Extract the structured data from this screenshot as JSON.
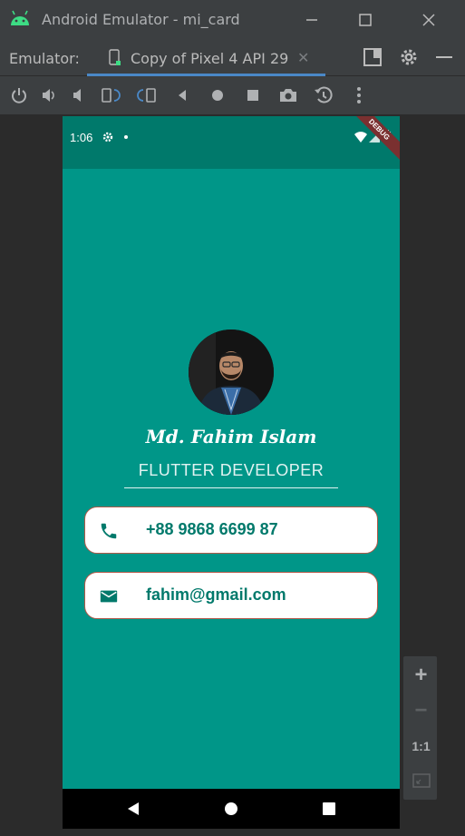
{
  "window": {
    "title": "Android Emulator - mi_card"
  },
  "tabbar": {
    "label": "Emulator:",
    "tab_title": "Copy of Pixel 4 API 29",
    "close_glyph": "✕"
  },
  "statusbar": {
    "time": "1:06",
    "debug_label": "DEBUG"
  },
  "profile": {
    "name": "Md. Fahim Islam",
    "role": "FLUTTER DEVELOPER"
  },
  "contacts": {
    "phone": "+88 9868 6699 87",
    "email": "fahim@gmail.com"
  },
  "zoom": {
    "in": "+",
    "out": "−",
    "one_to_one": "1:1"
  },
  "colors": {
    "teal": "#009688",
    "teal_dark": "#00796b",
    "ide_bg": "#3c3f41",
    "card_border": "#b25a4a",
    "accent": "#4a88c7"
  }
}
